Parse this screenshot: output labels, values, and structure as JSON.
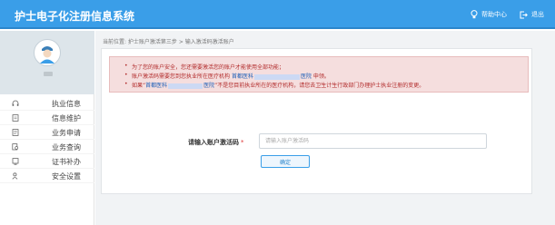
{
  "app": {
    "title": "护士电子化注册信息系统"
  },
  "topbar": {
    "help_label": "帮助中心",
    "help_icon": "lightbulb-icon",
    "logout_label": "退出",
    "logout_icon": "logout-icon"
  },
  "sidebar": {
    "profile": {
      "avatar_icon": "nurse-avatar-icon"
    },
    "items": [
      {
        "label": "执业信息",
        "icon": "headset-icon"
      },
      {
        "label": "信息维护",
        "icon": "document-icon"
      },
      {
        "label": "业务申请",
        "icon": "form-icon"
      },
      {
        "label": "业务查询",
        "icon": "search-doc-icon"
      },
      {
        "label": "证书补办",
        "icon": "certificate-icon"
      },
      {
        "label": "安全设置",
        "icon": "user-lock-icon"
      }
    ]
  },
  "main": {
    "breadcrumb": "当前位置: 护士账户激活第三步 > 输入激活码激活账户",
    "notice": {
      "line1": "为了您的账户安全，您还需要激活您的账户才能使用全部功能；",
      "line2_prefix": "账户激活码需要您到您执业所在医疗机构",
      "line2_org_start": "首都医科",
      "line2_org_end": "医院",
      "line2_suffix": "申领。",
      "line3_prefix": "如果“",
      "line3_org_start": "首都医科",
      "line3_org_end": "医院",
      "line3_suffix": "”不是您目前执业所在的医疗机构，请您去卫生计生行政部门办理护士执业注册的变更。"
    },
    "form": {
      "code_label": "请输入账户激活码",
      "required_mark": "*",
      "code_placeholder": "请输入账户激活码",
      "code_value": "",
      "confirm_label": "确定"
    }
  },
  "colors": {
    "topbar": "#3a9ee8",
    "notice_bg": "#f5dede",
    "notice_text": "#b12a2a",
    "link": "#1d5fb8"
  }
}
